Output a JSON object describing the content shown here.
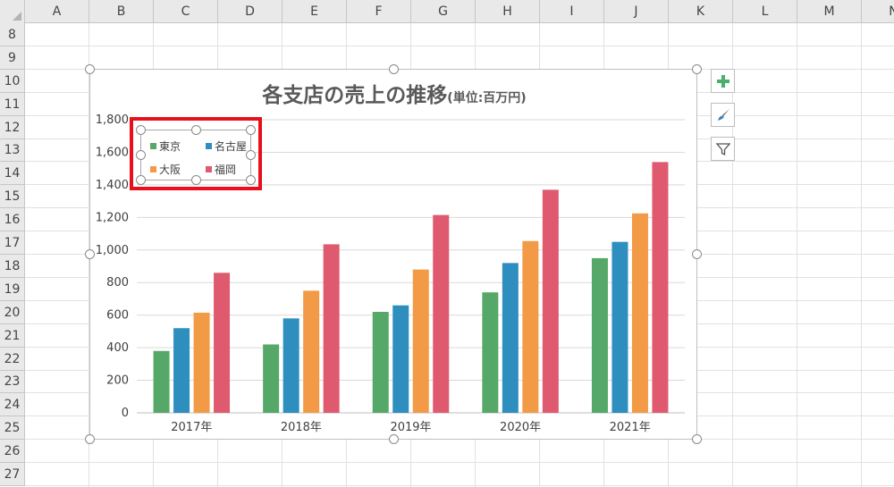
{
  "sheet": {
    "columns": [
      "A",
      "B",
      "C",
      "D",
      "E",
      "F",
      "G",
      "H",
      "I",
      "J",
      "K",
      "L",
      "M",
      "N"
    ],
    "rows": [
      "8",
      "9",
      "10",
      "11",
      "12",
      "13",
      "14",
      "15",
      "16",
      "17",
      "18",
      "19",
      "20",
      "21",
      "22",
      "23",
      "24",
      "25",
      "26",
      "27"
    ]
  },
  "chart": {
    "title": "各支店の売上の推移",
    "subtitle": "(単位:百万円)"
  },
  "chart_data": {
    "type": "bar",
    "title": "各支店の売上の推移(単位:百万円)",
    "categories": [
      "2017年",
      "2018年",
      "2019年",
      "2020年",
      "2021年"
    ],
    "series": [
      {
        "name": "東京",
        "values": [
          380,
          420,
          620,
          740,
          950
        ],
        "color": "#55a868"
      },
      {
        "name": "名古屋",
        "values": [
          520,
          580,
          660,
          920,
          1050
        ],
        "color": "#2e8fbf"
      },
      {
        "name": "大阪",
        "values": [
          615,
          750,
          880,
          1055,
          1225
        ],
        "color": "#f39a46"
      },
      {
        "name": "福岡",
        "values": [
          860,
          1035,
          1215,
          1370,
          1540
        ],
        "color": "#df5a6e"
      }
    ],
    "ylim": [
      0,
      1800
    ],
    "yticks": [
      "0",
      "200",
      "400",
      "600",
      "800",
      "1,000",
      "1,200",
      "1,400",
      "1,600",
      "1,800"
    ],
    "grid": true,
    "legend_position": "top-left"
  },
  "side_buttons": {
    "add": "plus-icon",
    "style": "brush-icon",
    "filter": "filter-icon"
  },
  "colors": {
    "highlight": "#e8101a"
  }
}
